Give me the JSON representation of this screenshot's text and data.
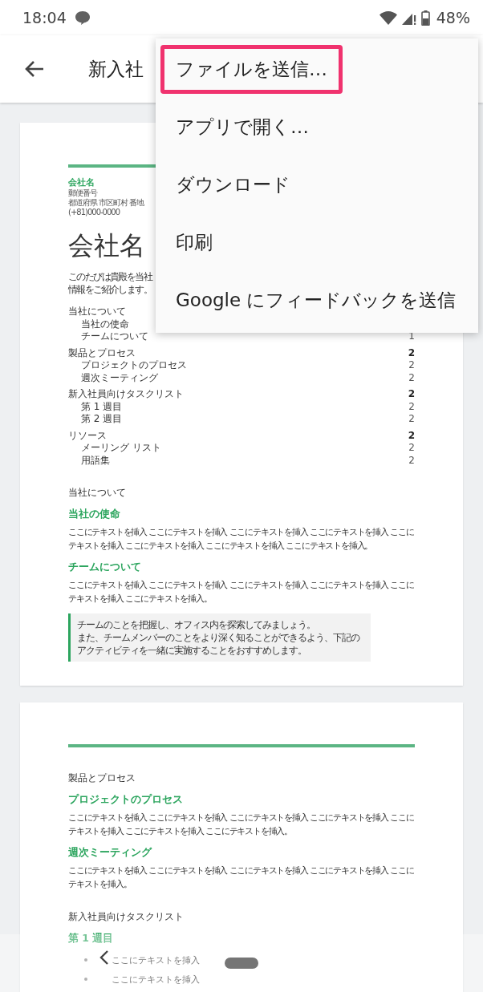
{
  "status_bar": {
    "time": "18:04",
    "battery": "48%"
  },
  "app_bar": {
    "title": "新入社"
  },
  "menu": [
    {
      "label": "ファイルを送信…",
      "highlighted": true
    },
    {
      "label": "アプリで開く…",
      "highlighted": false
    },
    {
      "label": "ダウンロード",
      "highlighted": false
    },
    {
      "label": "印刷",
      "highlighted": false
    },
    {
      "label": "Google にフィードバックを送信",
      "highlighted": false
    }
  ],
  "document": {
    "pages": [
      {
        "company": {
          "name": "会社名",
          "postal": "郵便番号",
          "address": "都道府県 市区町村 番地",
          "phone": "(+81)000-0000"
        },
        "title": "会社名",
        "intro_lines": [
          "このたびは貴殿を当社",
          "情報をご紹介します。"
        ],
        "toc": [
          {
            "label": "当社について",
            "children": [
              {
                "label": "当社の使命"
              },
              {
                "label": "チームについて",
                "page": "1"
              }
            ]
          },
          {
            "label": "製品とプロセス",
            "page": "2",
            "children": [
              {
                "label": "プロジェクトのプロセス",
                "page": "2"
              },
              {
                "label": "週次ミーティング",
                "page": "2"
              }
            ]
          },
          {
            "label": "新入社員向けタスクリスト",
            "page": "2",
            "children": [
              {
                "label": "第 1 週目",
                "page": "2"
              },
              {
                "label": "第 2 週目",
                "page": "2"
              }
            ]
          },
          {
            "label": "リソース",
            "page": "2",
            "children": [
              {
                "label": "メーリング リスト",
                "page": "2"
              },
              {
                "label": "用語集",
                "page": "2"
              }
            ]
          }
        ],
        "blocks": [
          {
            "kind": "heading",
            "text": "当社について"
          },
          {
            "kind": "subheading",
            "text": "当社の使命"
          },
          {
            "kind": "paragraph",
            "text": "ここにテキストを挿入 ここにテキストを挿入 ここにテキストを挿入 ここにテキストを挿入 ここにテキストを挿入 ここにテキストを挿入 ここにテキストを挿入 ここにテキストを挿入。"
          },
          {
            "kind": "subheading",
            "text": "チームについて"
          },
          {
            "kind": "paragraph",
            "text": "ここにテキストを挿入 ここにテキストを挿入 ここにテキストを挿入 ここにテキストを挿入 ここにテキストを挿入 ここにテキストを挿入。"
          },
          {
            "kind": "callout",
            "lines": [
              "チームのことを把握し、オフィス内を探索してみましょう。",
              "また、チームメンバーのことをより深く知ることができるよう、下記の",
              "アクティビティを一緒に実施することをおすすめします。"
            ]
          }
        ]
      },
      {
        "blocks": [
          {
            "kind": "heading",
            "text": "製品とプロセス"
          },
          {
            "kind": "subheading",
            "text": "プロジェクトのプロセス"
          },
          {
            "kind": "paragraph",
            "text": "ここにテキストを挿入 ここにテキストを挿入 ここにテキストを挿入 ここにテキストを挿入 ここにテキストを挿入 ここにテキストを挿入 ここにテキストを挿入。"
          },
          {
            "kind": "subheading",
            "text": "週次ミーティング"
          },
          {
            "kind": "paragraph",
            "text": "ここにテキストを挿入 ここにテキストを挿入 ここにテキストを挿入 ここにテキストを挿入 ここにテキストを挿入。"
          },
          {
            "kind": "heading",
            "text": "新入社員向けタスクリスト"
          },
          {
            "kind": "subheading",
            "text": "第 1 週目"
          },
          {
            "kind": "bullet",
            "text": "ここにテキストを挿入"
          },
          {
            "kind": "bullet",
            "text": "ここにテキストを挿入"
          }
        ]
      }
    ]
  }
}
